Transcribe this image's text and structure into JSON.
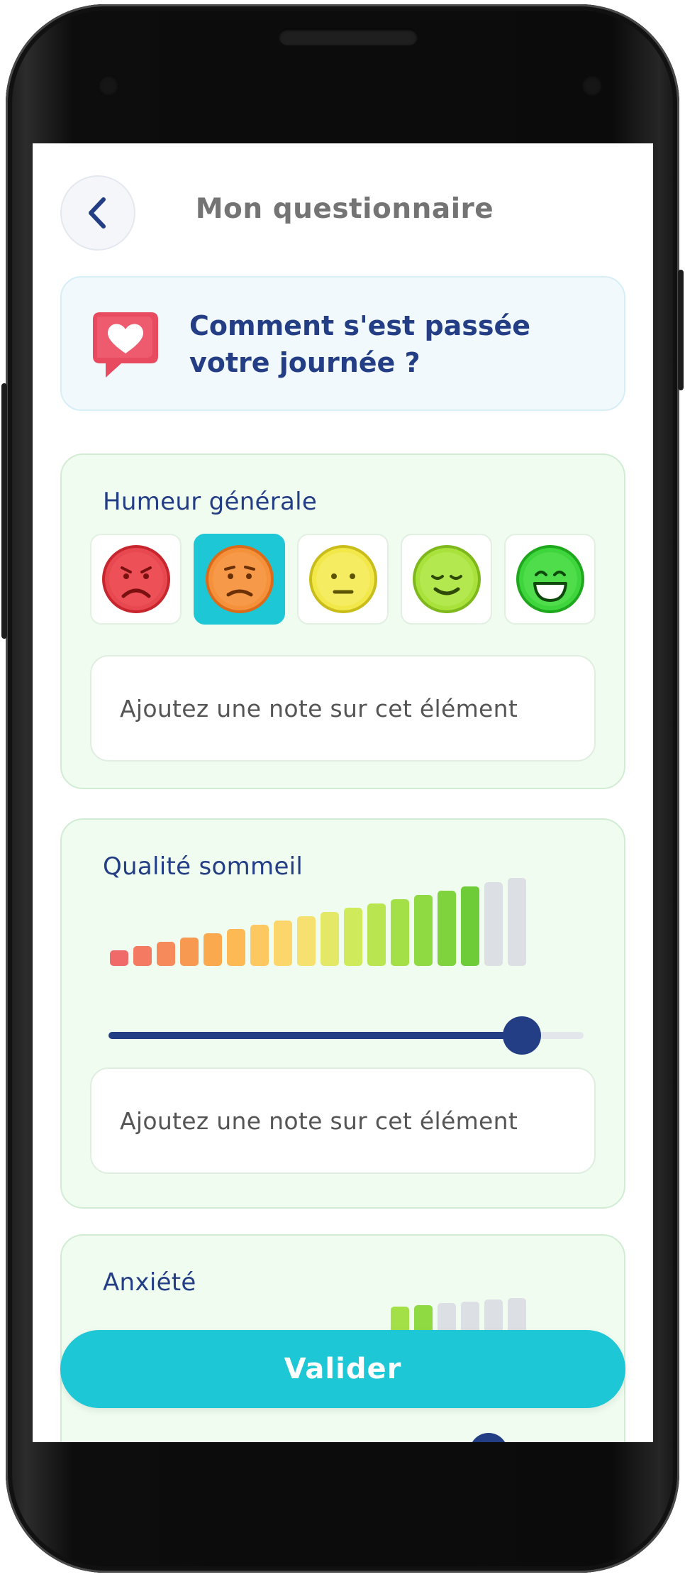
{
  "header": {
    "title": "Mon questionnaire"
  },
  "question": {
    "line1": "Comment s'est passée",
    "line2": "votre journée ?"
  },
  "humeur": {
    "title": "Humeur générale",
    "options": [
      {
        "mood": "very-sad",
        "color": "#e8484f",
        "selected": false
      },
      {
        "mood": "sad",
        "color": "#f5913a",
        "selected": true
      },
      {
        "mood": "neutral",
        "color": "#f3e84a",
        "selected": false
      },
      {
        "mood": "content",
        "color": "#a8e23a",
        "selected": false
      },
      {
        "mood": "very-happy",
        "color": "#3ed63c",
        "selected": false
      }
    ],
    "note_placeholder": "Ajoutez une note sur cet élément"
  },
  "sommeil": {
    "title": "Qualité sommeil",
    "level": 0.87,
    "note_placeholder": "Ajoutez une note sur cet élément"
  },
  "anxiete": {
    "title": "Anxiété",
    "level": 0.8
  },
  "footer": {
    "validate_label": "Valider"
  },
  "colors": {
    "primary": "#1ec7d5",
    "navy": "#243e86",
    "section_bg": "#effcef"
  }
}
